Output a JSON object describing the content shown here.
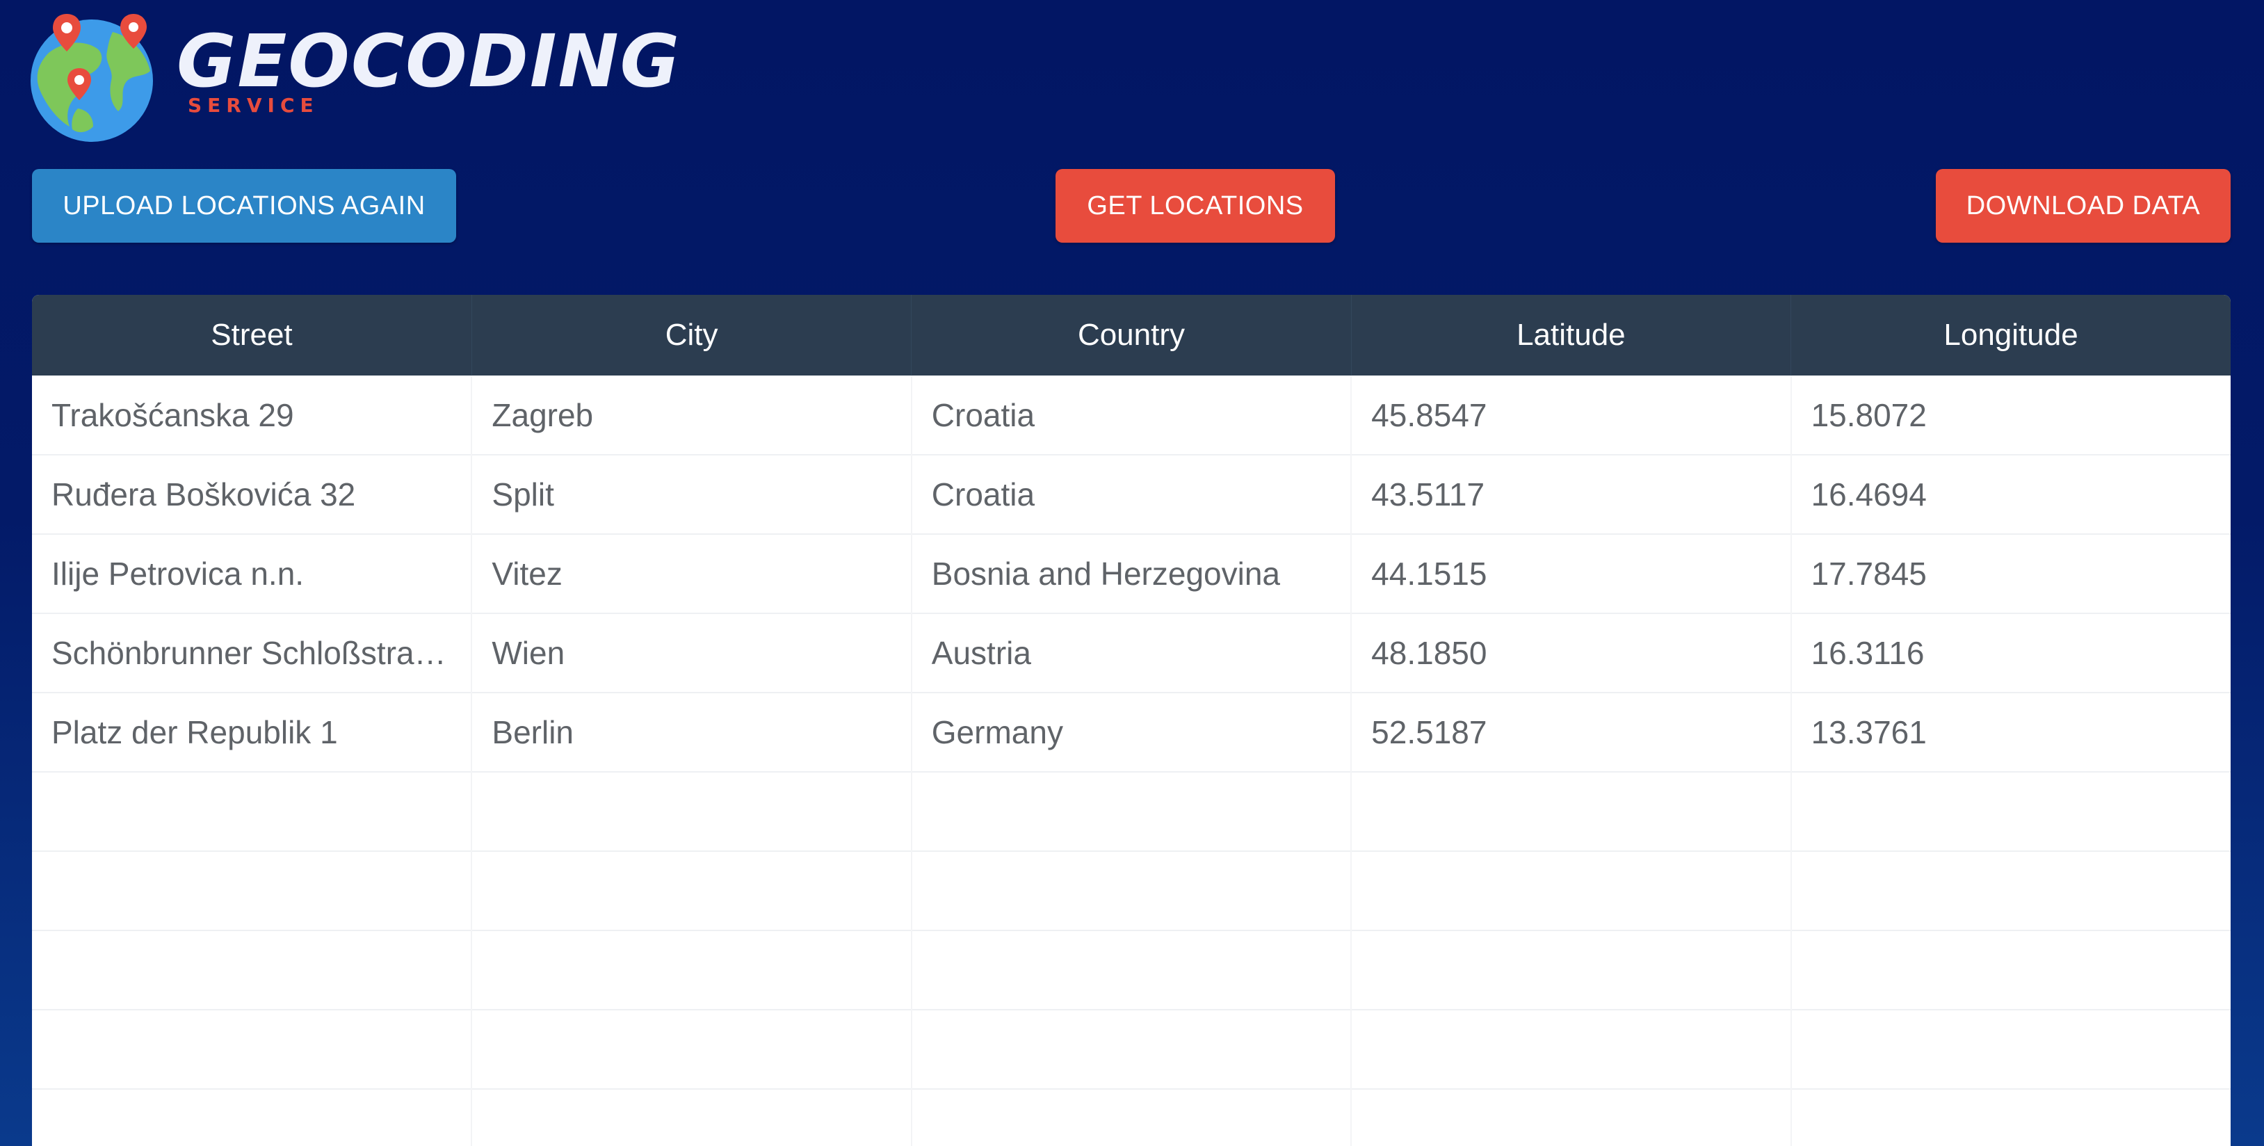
{
  "logo": {
    "title": "GEOCODING",
    "subtitle": "SERVICE"
  },
  "toolbar": {
    "upload_label": "UPLOAD LOCATIONS AGAIN",
    "get_label": "GET LOCATIONS",
    "download_label": "DOWNLOAD DATA"
  },
  "table": {
    "headers": [
      "Street",
      "City",
      "Country",
      "Latitude",
      "Longitude"
    ],
    "rows": [
      [
        "Trakošćanska 29",
        "Zagreb",
        "Croatia",
        "45.8547",
        "15.8072"
      ],
      [
        "Ruđera Boškovića 32",
        "Split",
        "Croatia",
        "43.5117",
        "16.4694"
      ],
      [
        "Ilije Petrovica n.n.",
        "Vitez",
        "Bosnia and Herzegovina",
        "44.1515",
        "17.7845"
      ],
      [
        "Schönbrunner Schloßstraße…",
        "Wien",
        "Austria",
        "48.1850",
        "16.3116"
      ],
      [
        "Platz der Republik 1",
        "Berlin",
        "Germany",
        "52.5187",
        "13.3761"
      ],
      [
        "",
        "",
        "",
        "",
        ""
      ],
      [
        "",
        "",
        "",
        "",
        ""
      ],
      [
        "",
        "",
        "",
        "",
        ""
      ],
      [
        "",
        "",
        "",
        "",
        ""
      ],
      [
        "",
        "",
        "",
        "",
        ""
      ]
    ]
  },
  "colors": {
    "background": "#021664",
    "upload_button": "#2b85c7",
    "action_button": "#e84c3d",
    "table_header": "#2c3d50"
  }
}
